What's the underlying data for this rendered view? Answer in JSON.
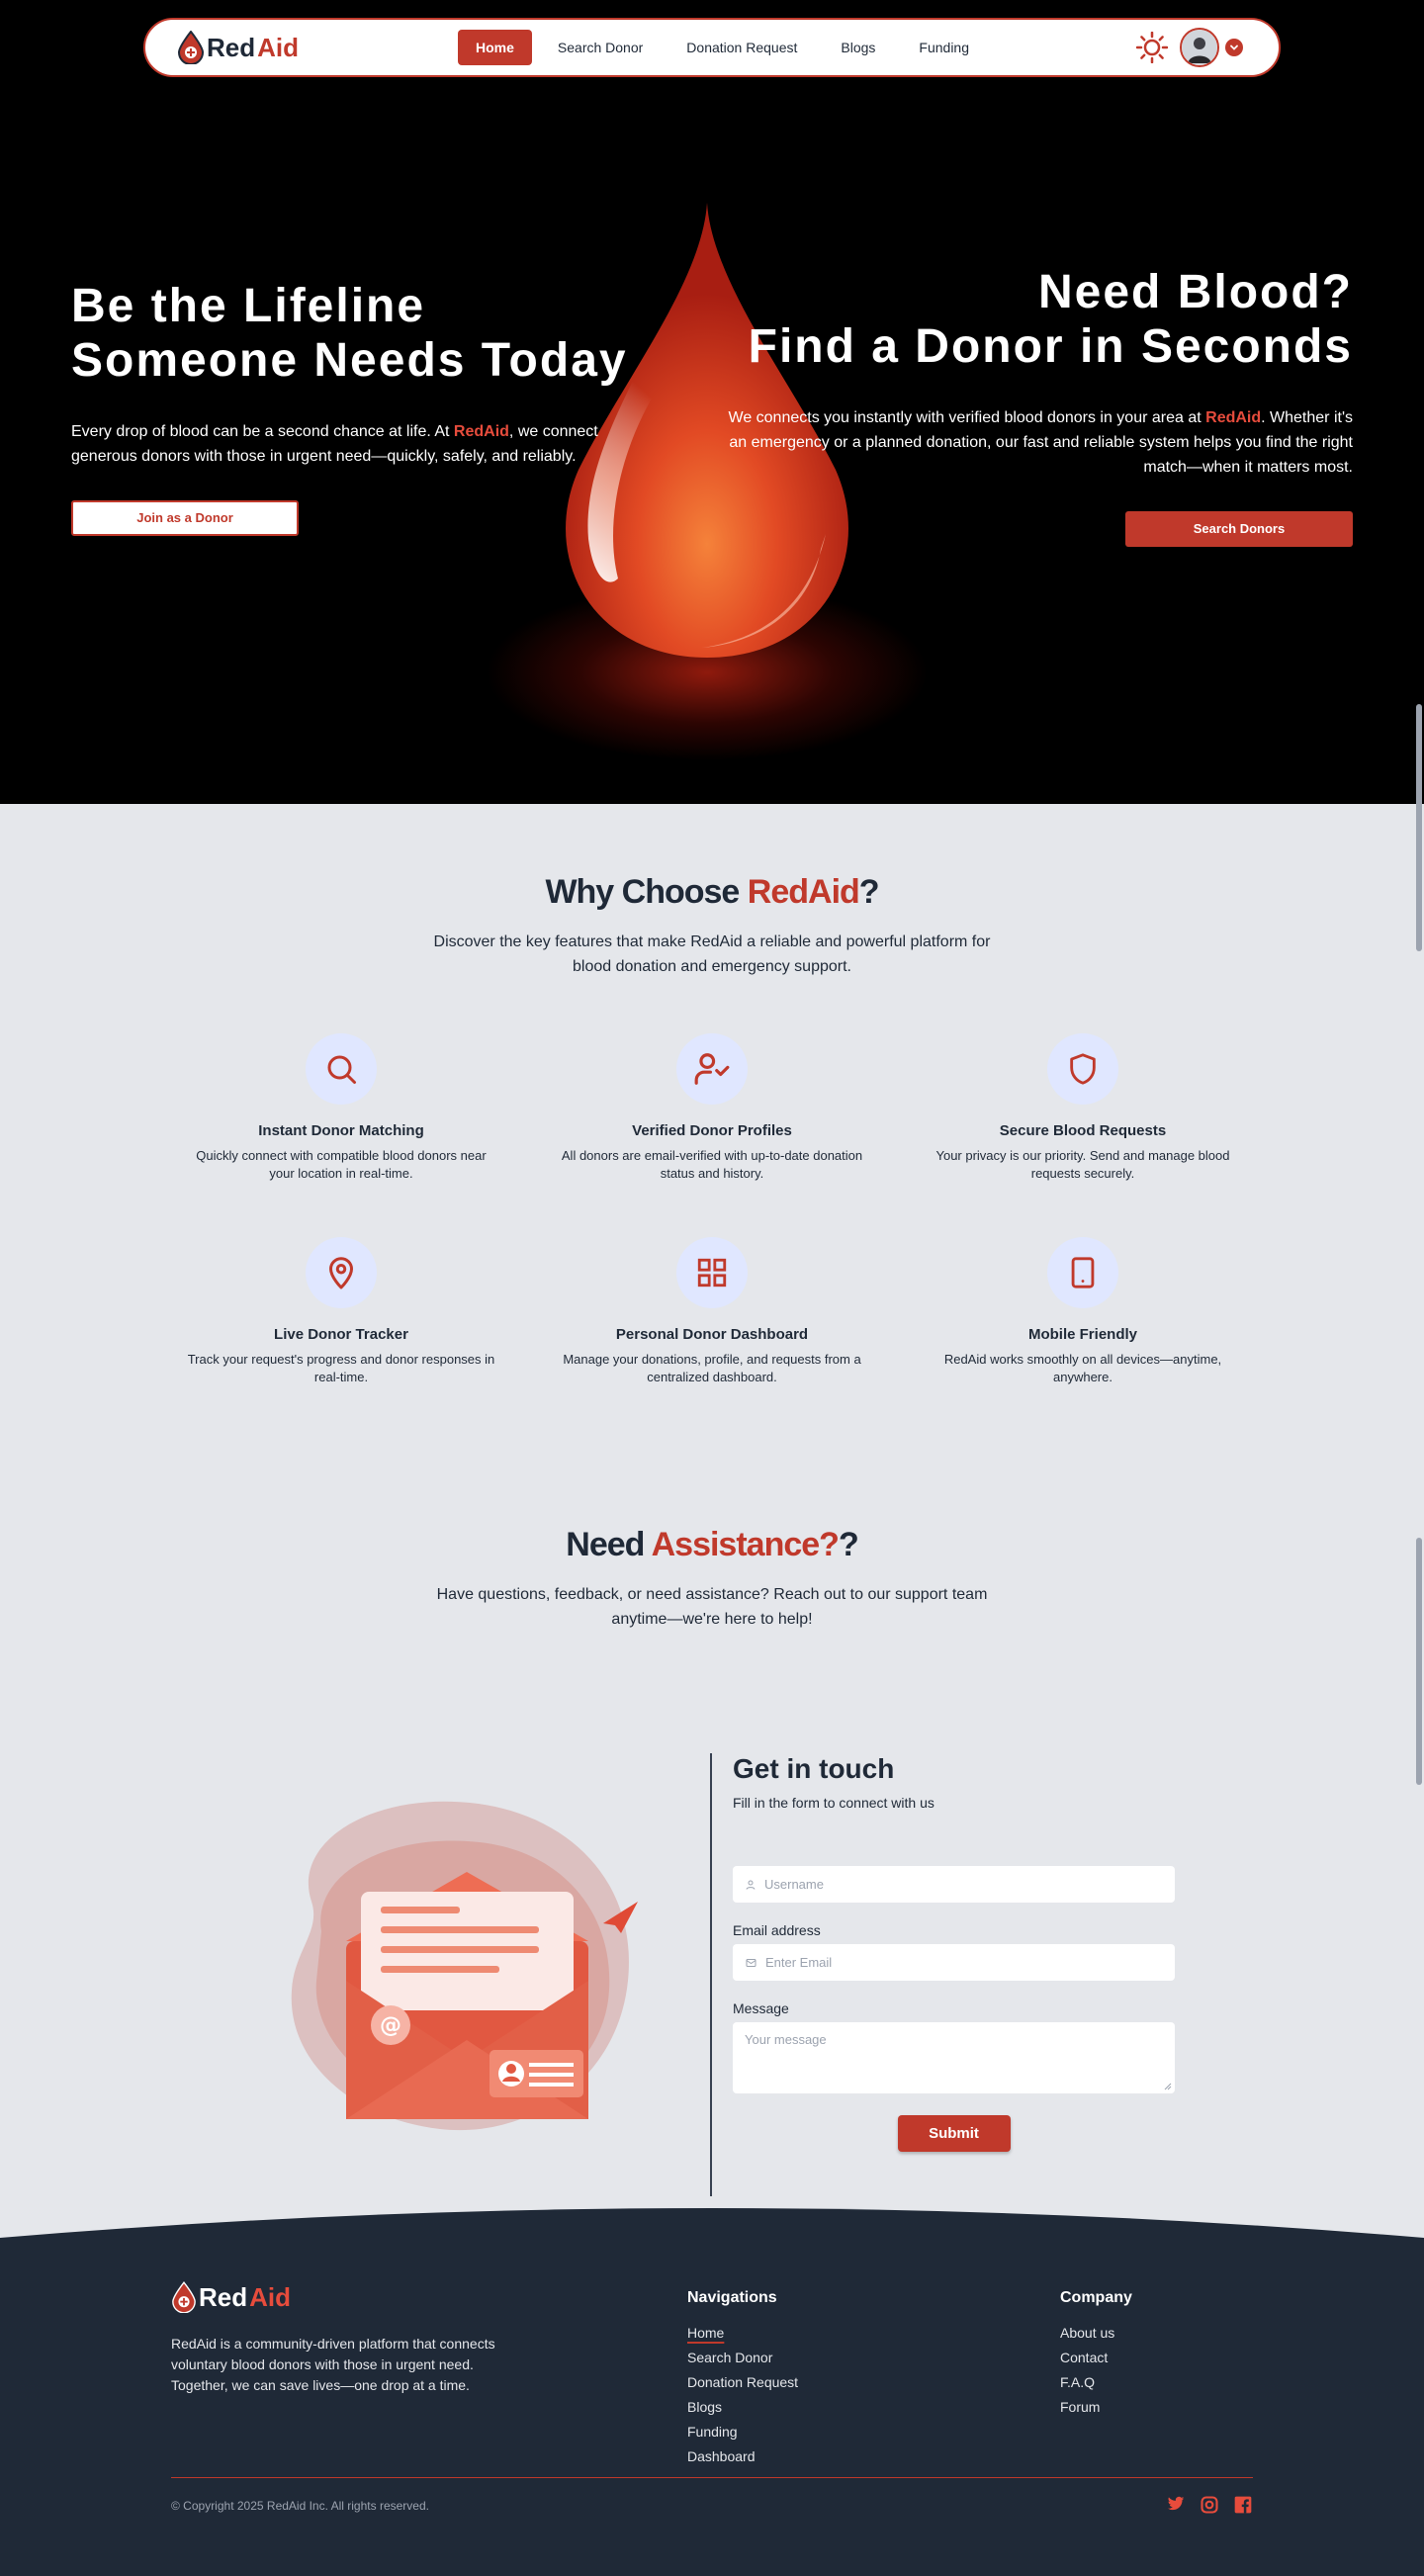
{
  "brand": {
    "part1": "Red",
    "part2": "Aid"
  },
  "nav": {
    "links": [
      {
        "label": "Home"
      },
      {
        "label": "Search Donor"
      },
      {
        "label": "Donation Request"
      },
      {
        "label": "Blogs"
      },
      {
        "label": "Funding"
      }
    ]
  },
  "hero": {
    "left": {
      "title_line1": "Be the Lifeline",
      "title_line2": "Someone Needs Today",
      "text_before": "Every drop of blood can be a second chance at life. At ",
      "text_brand": "RedAid",
      "text_after": ", we connect generous donors with those in urgent need—quickly, safely, and reliably.",
      "button": "Join as a Donor"
    },
    "right": {
      "title_line1": "Need Blood?",
      "title_line2": "Find a Donor in Seconds",
      "text_before": "We connects you instantly with verified blood donors in your area at ",
      "text_brand": "RedAid",
      "text_after": ". Whether it's an emergency or a planned donation, our fast and reliable system helps you find the right match—when it matters most.",
      "button": "Search Donors"
    }
  },
  "why": {
    "title_before": "Why Choose ",
    "title_accent": "RedAid",
    "title_after": "?",
    "subtitle": "Discover the key features that make RedAid a reliable and powerful platform for blood donation and emergency support.",
    "features": [
      {
        "icon": "search-icon",
        "title": "Instant Donor Matching",
        "desc": "Quickly connect with compatible blood donors near your location in real-time."
      },
      {
        "icon": "user-check-icon",
        "title": "Verified Donor Profiles",
        "desc": "All donors are email-verified with up-to-date donation status and history."
      },
      {
        "icon": "shield-icon",
        "title": "Secure Blood Requests",
        "desc": "Your privacy is our priority. Send and manage blood requests securely."
      },
      {
        "icon": "map-pin-icon",
        "title": "Live Donor Tracker",
        "desc": "Track your request's progress and donor responses in real-time."
      },
      {
        "icon": "dashboard-grid-icon",
        "title": "Personal Donor Dashboard",
        "desc": "Manage your donations, profile, and requests from a centralized dashboard."
      },
      {
        "icon": "tablet-icon",
        "title": "Mobile Friendly",
        "desc": "RedAid works smoothly on all devices—anytime, anywhere."
      }
    ]
  },
  "contact": {
    "title_before": "Need ",
    "title_accent": "Assistance?",
    "title_after": "?",
    "subtitle": "Have questions, feedback, or need assistance? Reach out to our support team anytime—we're here to help!",
    "form": {
      "title": "Get in touch",
      "subtitle": "Fill in the form to connect with us",
      "username_placeholder": "Username",
      "email_label": "Email address",
      "email_placeholder": "Enter Email",
      "message_label": "Message",
      "message_placeholder": "Your message",
      "submit": "Submit"
    }
  },
  "footer": {
    "description": "RedAid is a community-driven platform that connects voluntary blood donors with those in urgent need. Together, we can save lives—one drop at a time.",
    "nav_title": "Navigations",
    "nav_links": [
      "Home",
      "Search Donor",
      "Donation Request",
      "Blogs",
      "Funding",
      "Dashboard"
    ],
    "company_title": "Company",
    "company_links": [
      "About us",
      "Contact",
      "F.A.Q",
      "Forum"
    ],
    "copyright": "© Copyright 2025 RedAid Inc. All rights reserved.",
    "social": [
      "twitter-icon",
      "instagram-icon",
      "facebook-icon"
    ]
  },
  "colors": {
    "accent": "#c0392b",
    "footer_bg": "#1f2937",
    "page_bg": "#e5e7eb"
  }
}
